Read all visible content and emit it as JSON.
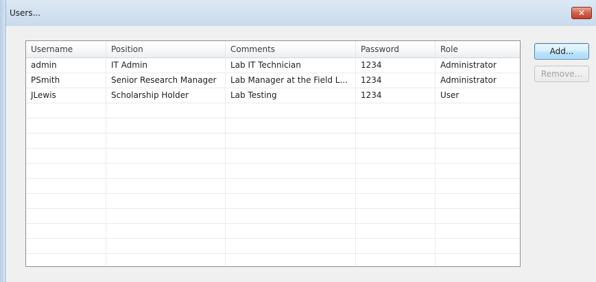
{
  "window": {
    "title": "Users...",
    "close_glyph": "✕"
  },
  "table": {
    "columns": [
      "Username",
      "Position",
      "Comments",
      "Password",
      "Role"
    ],
    "rows": [
      [
        "admin",
        "IT Admin",
        "Lab IT Technician",
        "1234",
        "Administrator"
      ],
      [
        "PSmith",
        "Senior Research Manager",
        "Lab Manager at the Field L...",
        "1234",
        "Administrator"
      ],
      [
        "JLewis",
        "Scholarship Holder",
        "Lab Testing",
        "1234",
        "User"
      ]
    ]
  },
  "buttons": {
    "add_label": "Add...",
    "remove_label": "Remove..."
  },
  "colors": {
    "titlebar": "#d3e2f1",
    "close_button": "#c2402a",
    "default_button_border": "#3c7fb1",
    "disabled_text": "#a0a0a0"
  }
}
